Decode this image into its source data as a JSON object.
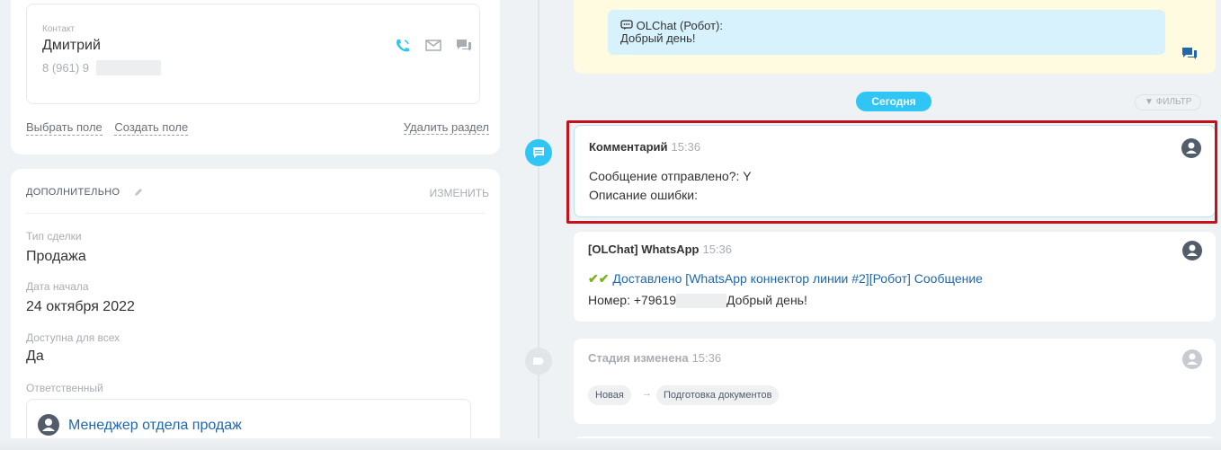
{
  "contact": {
    "caption": "Контакт",
    "name": "Дмитрий",
    "phone": "8 (961) 9",
    "icons": [
      "phone-icon",
      "mail-icon",
      "chat-icon"
    ]
  },
  "field_links": {
    "choose": "Выбрать поле",
    "create": "Создать поле",
    "delete": "Удалить раздел"
  },
  "extra": {
    "title": "дополнительно",
    "edit": "изменить",
    "fields": [
      {
        "label": "Тип сделки",
        "value": "Продажа"
      },
      {
        "label": "Дата начала",
        "value": "24 октября 2022"
      },
      {
        "label": "Доступна для всех",
        "value": "Да"
      },
      {
        "label": "Ответственный",
        "value": ""
      }
    ],
    "responsible": "Менеджер отдела продаж"
  },
  "chat": {
    "sender": "OLChat (Робот):",
    "text": "Добрый день!"
  },
  "timeline": {
    "today": "Сегодня",
    "filter": "фильтр",
    "events": [
      {
        "title": "Комментарий",
        "time": "15:36",
        "lines": [
          "Сообщение отправлено?: Y",
          "Описание ошибки:"
        ]
      },
      {
        "title": "[OLChat] WhatsApp",
        "time": "15:36",
        "checks": "✔✔",
        "link": "Доставлено [WhatsApp коннектор линии #2][Робот] Сообщение",
        "number_prefix": "Номер: +79619",
        "number_suffix": "Добрый день!"
      },
      {
        "title": "Стадия изменена",
        "time": "15:36",
        "from_stage": "Новая",
        "arrow": "→",
        "to_stage": "Подготовка документов"
      }
    ]
  },
  "colors": {
    "accent": "#2fc6f6",
    "link": "#2067b0",
    "highlight": "#c5121a",
    "chat_bg": "#fffbe0",
    "bubble_bg": "#d7f2fc"
  }
}
